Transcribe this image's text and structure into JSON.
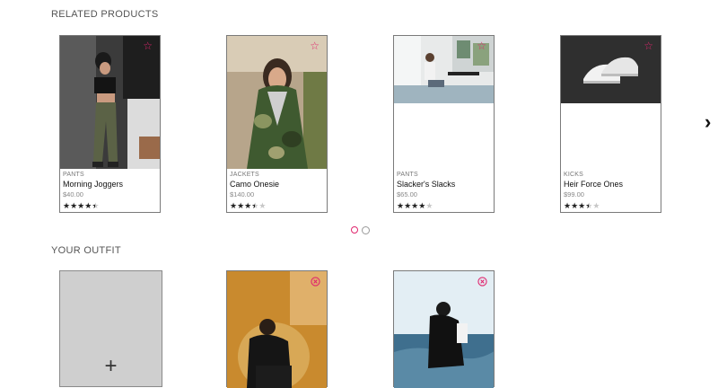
{
  "related": {
    "title": "RELATED PRODUCTS",
    "products": [
      {
        "category": "PANTS",
        "name": "Morning Joggers",
        "price": "$40.00",
        "rating": 4.5
      },
      {
        "category": "JACKETS",
        "name": "Camo Onesie",
        "price": "$140.00",
        "rating": 3.5
      },
      {
        "category": "PANTS",
        "name": "Slacker's Slacks",
        "price": "$65.00",
        "rating": 4
      },
      {
        "category": "KICKS",
        "name": "Heir Force Ones",
        "price": "$99.00",
        "rating": 3.5
      }
    ],
    "carousel_pages": 2,
    "carousel_active": 0,
    "next_icon": "chevron-right-icon",
    "favorite_icon": "star-outline-icon"
  },
  "outfit": {
    "title": "YOUR OUTFIT",
    "add_icon": "plus-icon",
    "remove_icon": "close-circle-icon"
  },
  "colors": {
    "accent": "#e0256d",
    "border": "#7a7a7a",
    "add_card_bg": "#cfcfcf"
  }
}
